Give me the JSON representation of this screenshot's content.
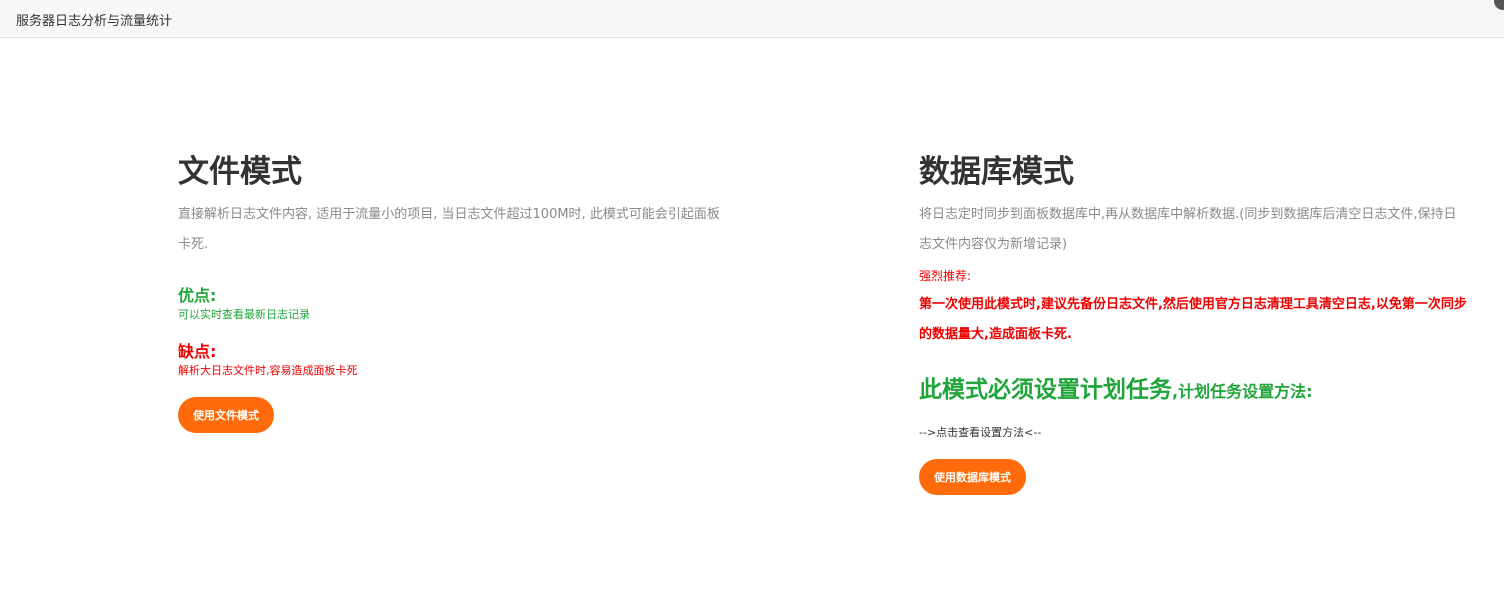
{
  "window": {
    "title": "服务器日志分析与流量统计"
  },
  "file_mode": {
    "title": "文件模式",
    "description": "直接解析日志文件内容, 适用于流量小的项目, 当日志文件超过100M时, 此模式可能会引起面板卡死.",
    "pros_title": "优点:",
    "pros_text": "可以实时查看最新日志记录",
    "cons_title": "缺点:",
    "cons_text": "解析大日志文件时,容易造成面板卡死",
    "button_label": "使用文件模式"
  },
  "db_mode": {
    "title": "数据库模式",
    "description": "将日志定时同步到面板数据库中,再从数据库中解析数据.(同步到数据库后清空日志文件,保持日志文件内容仅为新增记录)",
    "recommend_label": "强烈推荐:",
    "recommend_text": "第一次使用此模式时,建议先备份日志文件,然后使用官方日志清理工具清空日志,以免第一次同步的数据量大,造成面板卡死.",
    "must_big": "此模式必须设置计划任务",
    "must_small": ",计划任务设置方法:",
    "link_text": "-->点击查看设置方法<--",
    "button_label": "使用数据库模式"
  },
  "colors": {
    "accent_orange": "#ff6a0a",
    "success_green": "#20a53a",
    "danger_red": "#ee0000"
  }
}
